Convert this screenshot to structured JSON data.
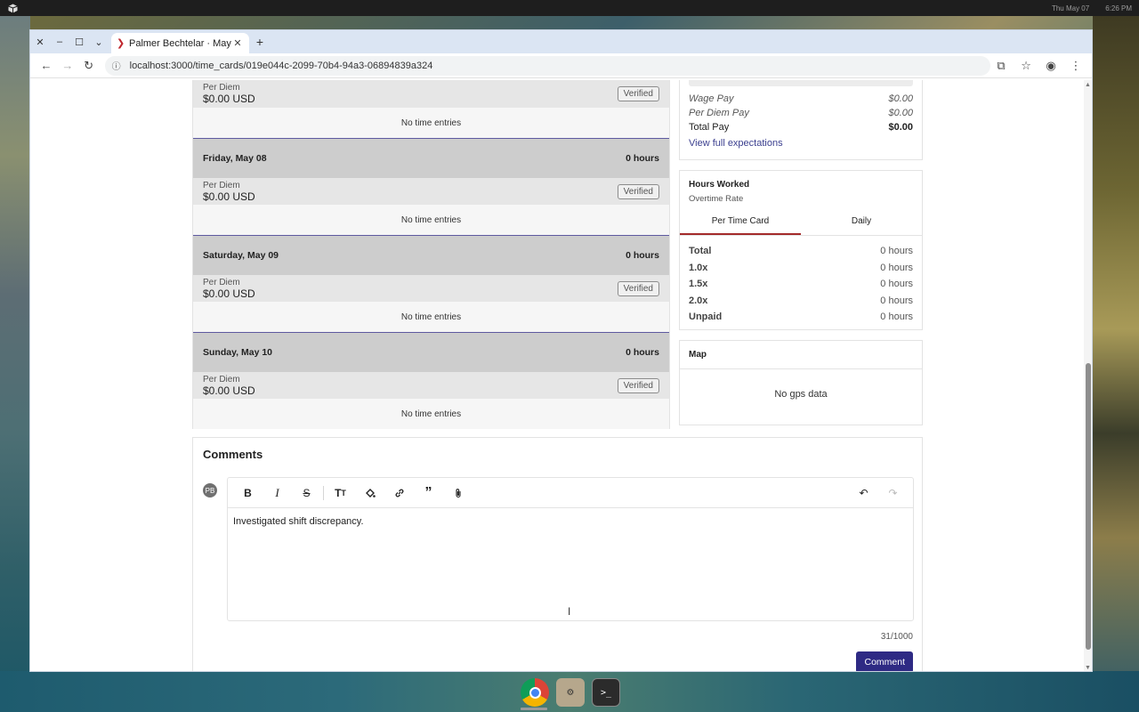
{
  "desktop": {
    "clock_date": "Thu May 07",
    "clock_time": "6:26 PM"
  },
  "browser": {
    "tab_title": "Palmer Bechtelar · May",
    "url": "localhost:3000/time_cards/019e044c-2099-70b4-94a3-06894839a324"
  },
  "days": [
    {
      "date": "",
      "hours": "",
      "per_diem_label": "Per Diem",
      "per_diem_amount": "$0.00 USD",
      "status": "Verified",
      "entries": "No time entries"
    },
    {
      "date": "Friday, May 08",
      "hours": "0 hours",
      "per_diem_label": "Per Diem",
      "per_diem_amount": "$0.00 USD",
      "status": "Verified",
      "entries": "No time entries"
    },
    {
      "date": "Saturday, May 09",
      "hours": "0 hours",
      "per_diem_label": "Per Diem",
      "per_diem_amount": "$0.00 USD",
      "status": "Verified",
      "entries": "No time entries"
    },
    {
      "date": "Sunday, May 10",
      "hours": "0 hours",
      "per_diem_label": "Per Diem",
      "per_diem_amount": "$0.00 USD",
      "status": "Verified",
      "entries": "No time entries"
    }
  ],
  "pay_summary": {
    "wage_pay_label": "Wage Pay",
    "wage_pay": "$0.00",
    "per_diem_pay_label": "Per Diem Pay",
    "per_diem_pay": "$0.00",
    "total_pay_label": "Total Pay",
    "total_pay": "$0.00",
    "link": "View full expectations"
  },
  "hours_worked": {
    "title": "Hours Worked",
    "subtitle": "Overtime Rate",
    "tabs": [
      "Per Time Card",
      "Daily"
    ],
    "rows": [
      {
        "label": "Total",
        "value": "0 hours"
      },
      {
        "label": "1.0x",
        "value": "0 hours"
      },
      {
        "label": "1.5x",
        "value": "0 hours"
      },
      {
        "label": "2.0x",
        "value": "0 hours"
      },
      {
        "label": "Unpaid",
        "value": "0 hours"
      }
    ]
  },
  "map": {
    "title": "Map",
    "empty": "No gps data"
  },
  "comments": {
    "title": "Comments",
    "avatar_initials": "PB",
    "body": "Investigated shift discrepancy.",
    "counter": "31/1000",
    "submit_label": "Comment"
  }
}
